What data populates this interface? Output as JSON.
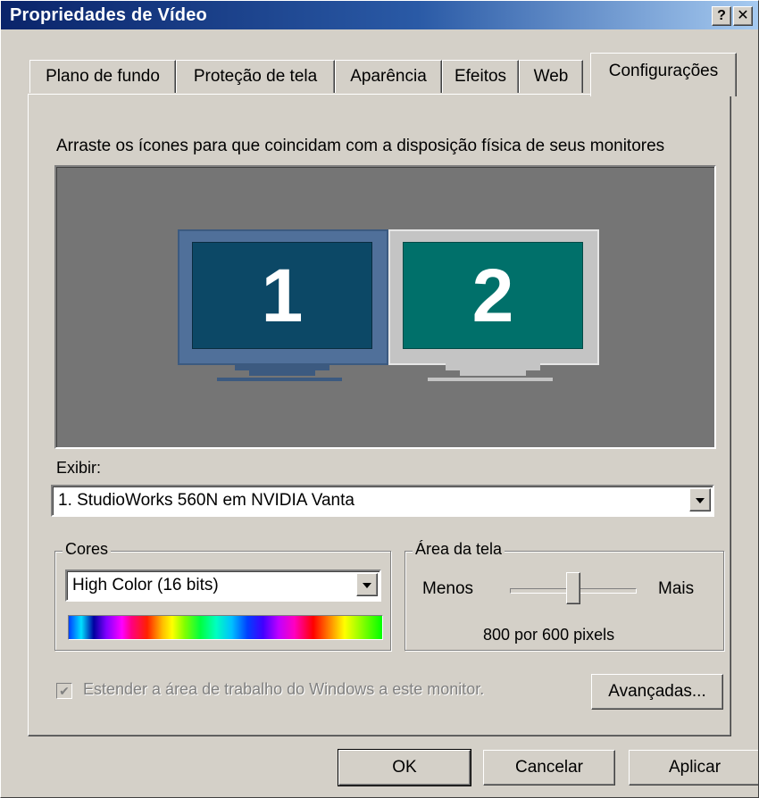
{
  "window": {
    "title": "Propriedades de Vídeo",
    "help_glyph": "?",
    "close_glyph": "✕"
  },
  "tabs": [
    {
      "label": "Plano de fundo",
      "active": false
    },
    {
      "label": "Proteção de tela",
      "active": false
    },
    {
      "label": "Aparência",
      "active": false
    },
    {
      "label": "Efeitos",
      "active": false
    },
    {
      "label": "Web",
      "active": false
    },
    {
      "label": "Configurações",
      "active": true
    }
  ],
  "settings": {
    "instruction": "Arraste os ícones para que coincidam com a disposição física de seus monitores",
    "monitors": [
      {
        "number": "1",
        "screen_color": "#0c4866",
        "frame_color": "#50709a",
        "selected": true
      },
      {
        "number": "2",
        "screen_color": "#00706a",
        "frame_color": "#c4c4c4",
        "selected": false
      }
    ],
    "display_label": "Exibir:",
    "display_value": "1. StudioWorks 560N em NVIDIA Vanta",
    "colors": {
      "group_title": "Cores",
      "value": "High Color (16 bits)"
    },
    "screen_area": {
      "group_title": "Área da tela",
      "less_label": "Menos",
      "more_label": "Mais",
      "value_text": "800 por 600 pixels",
      "slider_level": 0.45
    },
    "extend_checkbox": {
      "label": "Estender a área de trabalho do Windows a este monitor.",
      "checked": true,
      "enabled": false
    },
    "advanced_button": "Avançadas..."
  },
  "footer": {
    "ok": "OK",
    "cancel": "Cancelar",
    "apply": "Aplicar"
  },
  "colors_theme": {
    "titlebar_start": "#0a246a",
    "titlebar_end": "#a6caf0",
    "face": "#d4d0c8",
    "monitor_area": "#757575"
  }
}
